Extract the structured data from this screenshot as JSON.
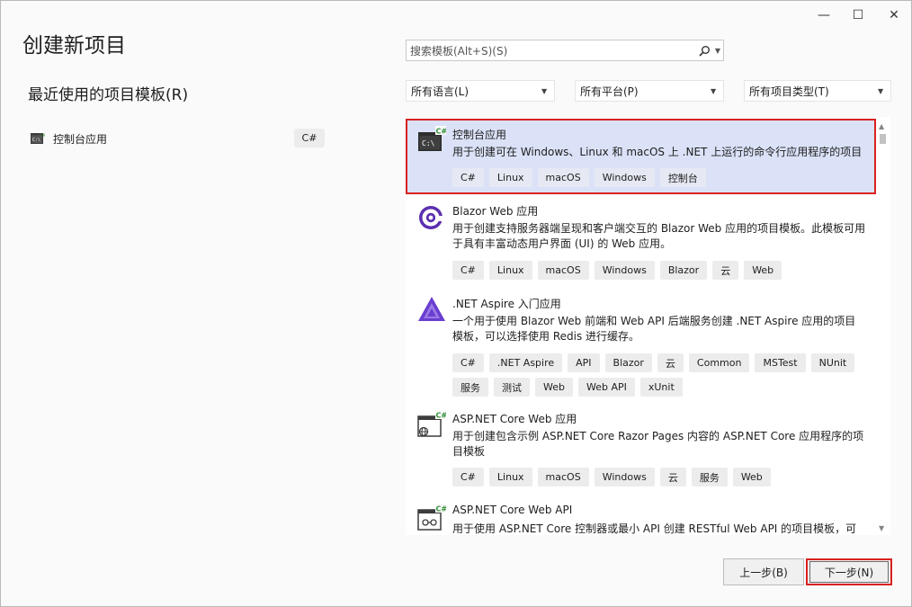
{
  "window": {
    "controls": {
      "minimize": "—",
      "maximize": "☐",
      "close": "✕"
    }
  },
  "title": "创建新项目",
  "recent": {
    "heading": "最近使用的项目模板(R)",
    "items": [
      {
        "label": "控制台应用",
        "badge": "C#",
        "icon": "console-app-icon"
      }
    ]
  },
  "search": {
    "placeholder": "搜索模板(Alt+S)(S)"
  },
  "filters": {
    "language": "所有语言(L)",
    "platform": "所有平台(P)",
    "type": "所有项目类型(T)"
  },
  "templates": [
    {
      "name": "控制台应用",
      "icon": "console-app-icon",
      "description": "用于创建可在 Windows、Linux 和 macOS 上 .NET 上运行的命令行应用程序的项目",
      "tags": [
        "C#",
        "Linux",
        "macOS",
        "Windows",
        "控制台"
      ],
      "selected": true
    },
    {
      "name": "Blazor Web 应用",
      "icon": "blazor-icon",
      "description": "用于创建支持服务器端呈现和客户端交互的 Blazor Web 应用的项目模板。此模板可用于具有丰富动态用户界面 (UI) 的 Web 应用。",
      "tags": [
        "C#",
        "Linux",
        "macOS",
        "Windows",
        "Blazor",
        "云",
        "Web"
      ]
    },
    {
      "name": ".NET Aspire 入门应用",
      "icon": "aspire-icon",
      "description": "一个用于使用 Blazor Web 前端和 Web API 后端服务创建 .NET Aspire 应用的项目模板，可以选择使用 Redis 进行缓存。",
      "tags": [
        "C#",
        ".NET Aspire",
        "API",
        "Blazor",
        "云",
        "Common",
        "MSTest",
        "NUnit",
        "服务",
        "测试",
        "Web",
        "Web API",
        "xUnit"
      ]
    },
    {
      "name": "ASP.NET Core Web 应用",
      "icon": "aspnet-web-icon",
      "description": "用于创建包含示例 ASP.NET Core Razor Pages 内容的 ASP.NET Core 应用程序的项目模板",
      "tags": [
        "C#",
        "Linux",
        "macOS",
        "Windows",
        "云",
        "服务",
        "Web"
      ]
    },
    {
      "name": "ASP.NET Core Web API",
      "icon": "aspnet-api-icon",
      "description": "用于使用 ASP.NET Core 控制器或最小 API 创建 RESTful Web API 的项目模板，可",
      "tags": []
    }
  ],
  "buttons": {
    "back": "上一步(B)",
    "next": "下一步(N)"
  },
  "colors": {
    "selection_bg": "#dbe2f8",
    "highlight_border": "#d92121",
    "accent": "#68217a"
  }
}
